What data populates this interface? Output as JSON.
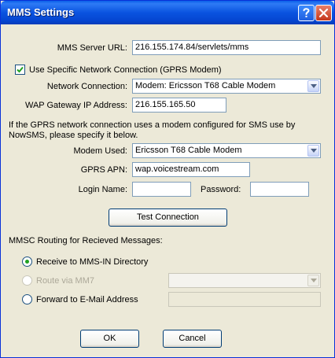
{
  "window": {
    "title": "MMS Settings"
  },
  "server": {
    "url_label": "MMS Server URL:",
    "url_value": "216.155.174.84/servlets/mms"
  },
  "network": {
    "use_specific_label": "Use Specific Network Connection (GPRS Modem)",
    "use_specific_checked": true,
    "connection_label": "Network Connection:",
    "connection_value": "Modem: Ericsson T68 Cable Modem",
    "wap_label": "WAP Gateway IP Address:",
    "wap_value": "216.155.165.50",
    "info_line1": "If the GPRS network connection uses a modem configured for SMS use by",
    "info_line2": "NowSMS, please specify it below.",
    "modem_label": "Modem Used:",
    "modem_value": "Ericsson T68 Cable Modem",
    "apn_label": "GPRS APN:",
    "apn_value": "wap.voicestream.com",
    "login_label": "Login Name:",
    "login_value": "",
    "password_label": "Password:",
    "password_value": "",
    "test_button": "Test Connection"
  },
  "routing": {
    "heading": "MMSC Routing for Recieved Messages:",
    "options": [
      {
        "label": "Receive to MMS-IN Directory",
        "selected": true,
        "enabled": true
      },
      {
        "label": "Route via MM7",
        "selected": false,
        "enabled": false
      },
      {
        "label": "Forward to E-Mail Address",
        "selected": false,
        "enabled": true
      }
    ],
    "mm7_value": "",
    "email_value": ""
  },
  "footer": {
    "ok": "OK",
    "cancel": "Cancel"
  },
  "colors": {
    "titlebar": "#0A53E0",
    "face": "#ECE9D8",
    "radio_dot": "#21A121"
  }
}
